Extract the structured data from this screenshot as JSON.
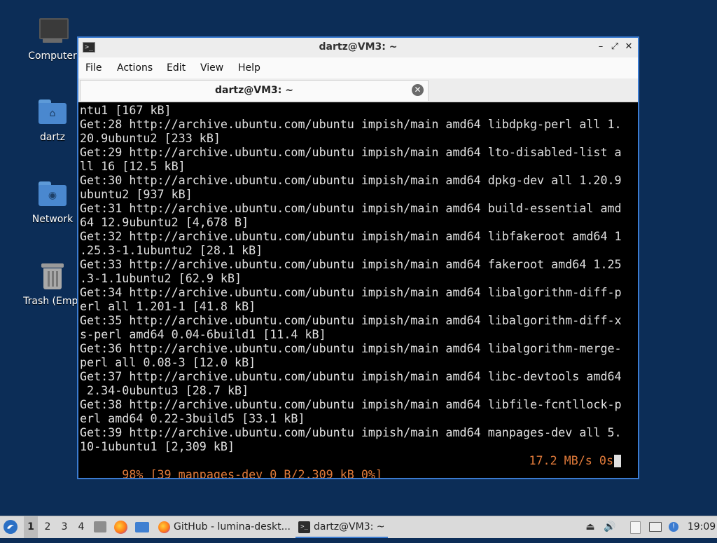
{
  "desktop": {
    "icons": [
      {
        "label": "Computer",
        "icon": "computer-icon"
      },
      {
        "label": "dartz",
        "icon": "home-folder-icon"
      },
      {
        "label": "Network",
        "icon": "network-folder-icon"
      },
      {
        "label": "Trash (Empt",
        "icon": "trash-icon"
      }
    ]
  },
  "window": {
    "title": "dartz@VM3: ~",
    "menu": [
      "File",
      "Actions",
      "Edit",
      "View",
      "Help"
    ],
    "tab_label": "dartz@VM3: ~",
    "controls": {
      "minimize": "–",
      "maximize": "⤢",
      "close": "✕"
    }
  },
  "terminal": {
    "lines": [
      "ntu1 [167 kB]",
      "Get:28 http://archive.ubuntu.com/ubuntu impish/main amd64 libdpkg-perl all 1.",
      "20.9ubuntu2 [233 kB]",
      "Get:29 http://archive.ubuntu.com/ubuntu impish/main amd64 lto-disabled-list a",
      "ll 16 [12.5 kB]",
      "Get:30 http://archive.ubuntu.com/ubuntu impish/main amd64 dpkg-dev all 1.20.9",
      "ubuntu2 [937 kB]",
      "Get:31 http://archive.ubuntu.com/ubuntu impish/main amd64 build-essential amd",
      "64 12.9ubuntu2 [4,678 B]",
      "Get:32 http://archive.ubuntu.com/ubuntu impish/main amd64 libfakeroot amd64 1",
      ".25.3-1.1ubuntu2 [28.1 kB]",
      "Get:33 http://archive.ubuntu.com/ubuntu impish/main amd64 fakeroot amd64 1.25",
      ".3-1.1ubuntu2 [62.9 kB]",
      "Get:34 http://archive.ubuntu.com/ubuntu impish/main amd64 libalgorithm-diff-p",
      "erl all 1.201-1 [41.8 kB]",
      "Get:35 http://archive.ubuntu.com/ubuntu impish/main amd64 libalgorithm-diff-x",
      "s-perl amd64 0.04-6build1 [11.4 kB]",
      "Get:36 http://archive.ubuntu.com/ubuntu impish/main amd64 libalgorithm-merge-",
      "perl all 0.08-3 [12.0 kB]",
      "Get:37 http://archive.ubuntu.com/ubuntu impish/main amd64 libc-devtools amd64",
      " 2.34-0ubuntu3 [28.7 kB]",
      "Get:38 http://archive.ubuntu.com/ubuntu impish/main amd64 libfile-fcntllock-p",
      "erl amd64 0.22-3build5 [33.1 kB]",
      "Get:39 http://archive.ubuntu.com/ubuntu impish/main amd64 manpages-dev all 5.",
      "10-1ubuntu1 [2,309 kB]"
    ],
    "progress_left": "98% [39 manpages-dev 0 B/2,309 kB 0%]",
    "progress_right": "17.2 MB/s 0s"
  },
  "taskbar": {
    "workspaces": [
      "1",
      "2",
      "3",
      "4"
    ],
    "active_workspace": "1",
    "tasks": [
      {
        "label": "GitHub - lumina-deskt...",
        "icon": "firefox-icon"
      },
      {
        "label": "dartz@VM3: ~",
        "icon": "terminal-icon"
      }
    ],
    "clock": "19:09"
  },
  "colors": {
    "desktop_bg": "#0c2d57",
    "window_border": "#3b7bd0",
    "progress_text": "#e07a3a"
  }
}
